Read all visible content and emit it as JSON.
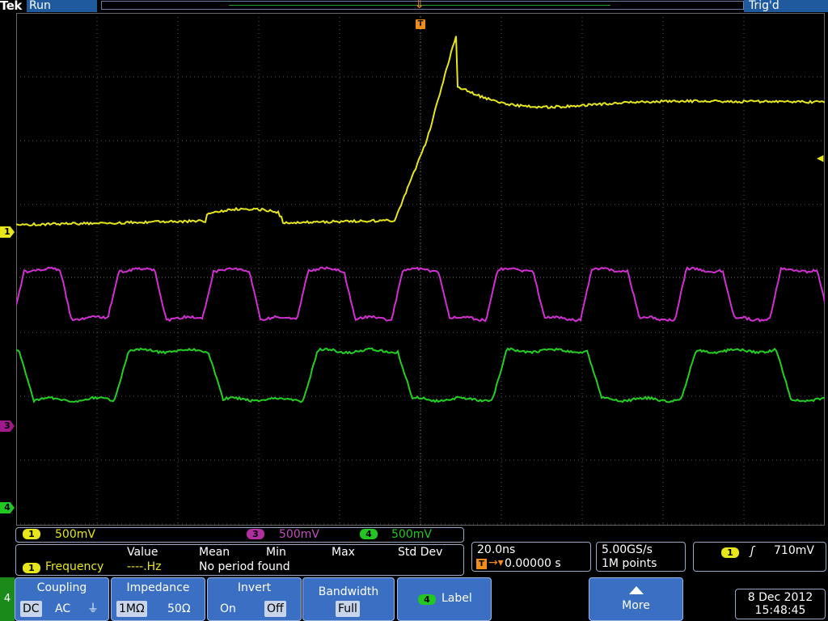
{
  "status": {
    "brand": "Tek",
    "run_state": "Run",
    "trigger_state": "Trig'd",
    "trigger_marker": "T"
  },
  "channels": [
    {
      "id": "1",
      "scale": "500mV",
      "color": "#e6e61a"
    },
    {
      "id": "3",
      "scale": "500mV",
      "color": "#c24dbb"
    },
    {
      "id": "4",
      "scale": "500mV",
      "color": "#22c722"
    }
  ],
  "measurement": {
    "headers": [
      "Value",
      "Mean",
      "Min",
      "Max",
      "Std Dev"
    ],
    "channel": "1",
    "name": "Frequency",
    "value": "----.Hz",
    "message": "No period found"
  },
  "horizontal": {
    "scale": "20.0ns",
    "position": "0.00000 s"
  },
  "acquisition": {
    "sample_rate": "5.00GS/s",
    "record_length": "1M points"
  },
  "trigger": {
    "channel": "1",
    "slope_icon": "rising-edge-icon",
    "level": "710mV"
  },
  "menu": {
    "tab": "4",
    "coupling": {
      "label": "Coupling",
      "options": [
        "DC",
        "AC",
        "⏚"
      ],
      "selected": "DC"
    },
    "impedance": {
      "label": "Impedance",
      "options": [
        "1MΩ",
        "50Ω"
      ],
      "selected": "1MΩ"
    },
    "invert": {
      "label": "Invert",
      "options": [
        "On",
        "Off"
      ],
      "selected": "Off"
    },
    "bandwidth": {
      "label": "Bandwidth",
      "value": "Full"
    },
    "label_button": {
      "channel": "4",
      "label": "Label"
    },
    "more": {
      "label": "More",
      "icon": "up-arrow-icon"
    }
  },
  "datetime": {
    "date": "8 Dec 2012",
    "time": "15:48:45"
  }
}
